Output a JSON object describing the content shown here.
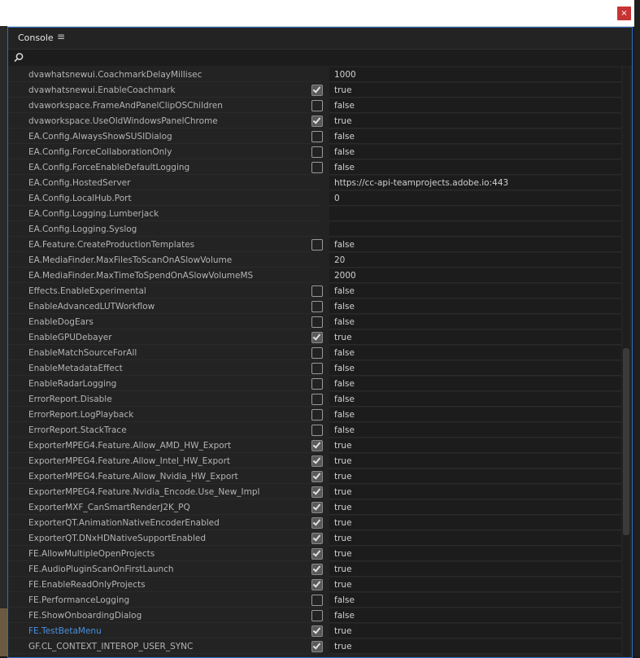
{
  "window": {
    "close_label": "×"
  },
  "panel": {
    "title": "Console",
    "menu_label": "≡"
  },
  "search": {
    "icon": "search-icon"
  },
  "rows": [
    {
      "key": "dvawhatsnewui.CoachmarkDelayMillisec",
      "check": null,
      "value": "1000"
    },
    {
      "key": "dvawhatsnewui.EnableCoachmark",
      "check": true,
      "value": "true"
    },
    {
      "key": "dvaworkspace.FrameAndPanelClipOSChildren",
      "check": false,
      "value": "false"
    },
    {
      "key": "dvaworkspace.UseOldWindowsPanelChrome",
      "check": true,
      "value": "true"
    },
    {
      "key": "EA.Config.AlwaysShowSUSIDialog",
      "check": false,
      "value": "false"
    },
    {
      "key": "EA.Config.ForceCollaborationOnly",
      "check": false,
      "value": "false"
    },
    {
      "key": "EA.Config.ForceEnableDefaultLogging",
      "check": false,
      "value": "false"
    },
    {
      "key": "EA.Config.HostedServer",
      "check": null,
      "value": "https://cc-api-teamprojects.adobe.io:443"
    },
    {
      "key": "EA.Config.LocalHub.Port",
      "check": null,
      "value": "0"
    },
    {
      "key": "EA.Config.Logging.Lumberjack",
      "check": null,
      "value": ""
    },
    {
      "key": "EA.Config.Logging.Syslog",
      "check": null,
      "value": ""
    },
    {
      "key": "EA.Feature.CreateProductionTemplates",
      "check": false,
      "value": "false"
    },
    {
      "key": "EA.MediaFinder.MaxFilesToScanOnASlowVolume",
      "check": null,
      "value": "20"
    },
    {
      "key": "EA.MediaFinder.MaxTimeToSpendOnASlowVolumeMS",
      "check": null,
      "value": "2000"
    },
    {
      "key": "Effects.EnableExperimental",
      "check": false,
      "value": "false"
    },
    {
      "key": "EnableAdvancedLUTWorkflow",
      "check": false,
      "value": "false"
    },
    {
      "key": "EnableDogEars",
      "check": false,
      "value": "false"
    },
    {
      "key": "EnableGPUDebayer",
      "check": true,
      "value": "true"
    },
    {
      "key": "EnableMatchSourceForAll",
      "check": false,
      "value": "false"
    },
    {
      "key": "EnableMetadataEffect",
      "check": false,
      "value": "false"
    },
    {
      "key": "EnableRadarLogging",
      "check": false,
      "value": "false"
    },
    {
      "key": "ErrorReport.Disable",
      "check": false,
      "value": "false"
    },
    {
      "key": "ErrorReport.LogPlayback",
      "check": false,
      "value": "false"
    },
    {
      "key": "ErrorReport.StackTrace",
      "check": false,
      "value": "false"
    },
    {
      "key": "ExporterMPEG4.Feature.Allow_AMD_HW_Export",
      "check": true,
      "value": "true"
    },
    {
      "key": "ExporterMPEG4.Feature.Allow_Intel_HW_Export",
      "check": true,
      "value": "true"
    },
    {
      "key": "ExporterMPEG4.Feature.Allow_Nvidia_HW_Export",
      "check": true,
      "value": "true"
    },
    {
      "key": "ExporterMPEG4.Feature.Nvidia_Encode.Use_New_Impl",
      "check": true,
      "value": "true"
    },
    {
      "key": "ExporterMXF_CanSmartRenderJ2K_PQ",
      "check": true,
      "value": "true"
    },
    {
      "key": "ExporterQT.AnimationNativeEncoderEnabled",
      "check": true,
      "value": "true"
    },
    {
      "key": "ExporterQT.DNxHDNativeSupportEnabled",
      "check": true,
      "value": "true"
    },
    {
      "key": "FE.AllowMultipleOpenProjects",
      "check": true,
      "value": "true"
    },
    {
      "key": "FE.AudioPluginScanOnFirstLaunch",
      "check": true,
      "value": "true"
    },
    {
      "key": "FE.EnableReadOnlyProjects",
      "check": true,
      "value": "true"
    },
    {
      "key": "FE.PerformanceLogging",
      "check": false,
      "value": "false"
    },
    {
      "key": "FE.ShowOnboardingDialog",
      "check": false,
      "value": "false"
    },
    {
      "key": "FE.TestBetaMenu",
      "check": true,
      "value": "true",
      "link": true
    },
    {
      "key": "GF.CL_CONTEXT_INTEROP_USER_SYNC",
      "check": true,
      "value": "true"
    }
  ]
}
